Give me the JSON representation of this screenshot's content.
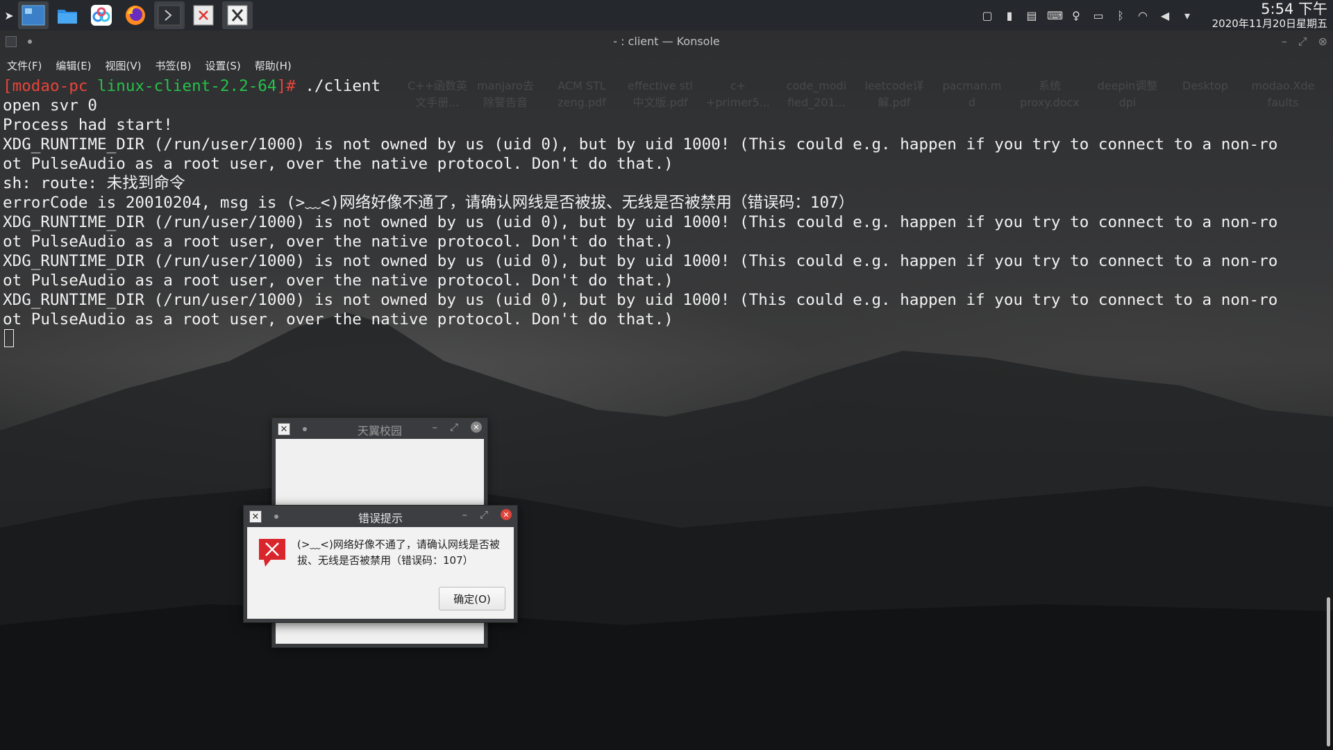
{
  "taskbar": {
    "launcher_icon": "launcher-arrow-icon",
    "tasks": [
      {
        "name": "desktop-icon",
        "active": true
      },
      {
        "name": "file-manager-icon",
        "active": false
      },
      {
        "name": "baidu-netdisk-icon",
        "active": false
      },
      {
        "name": "firefox-icon",
        "active": false
      },
      {
        "name": "konsole-icon",
        "active": true
      },
      {
        "name": "error-app-icon",
        "active": false
      },
      {
        "name": "x-app-icon",
        "active": true
      }
    ],
    "tray_icons": [
      "window-icon",
      "clipboard-icon",
      "notes-icon",
      "keyboard-icon",
      "bulb-icon",
      "battery-icon",
      "bluetooth-icon",
      "wifi-icon",
      "volume-icon",
      "expand-icon"
    ],
    "clock_time": "5:54 下午",
    "clock_date": "2020年11月20日星期五"
  },
  "konsole": {
    "title": "- : client — Konsole",
    "menu": [
      "文件(F)",
      "编辑(E)",
      "视图(V)",
      "书签(B)",
      "设置(S)",
      "帮助(H)"
    ],
    "prompt_user": "[modao-pc",
    "prompt_dir": "linux-client-2.2-64",
    "prompt_mark": "]#",
    "command": " ./client",
    "lines": [
      "open svr 0",
      "Process had start!",
      "XDG_RUNTIME_DIR (/run/user/1000) is not owned by us (uid 0), but by uid 1000! (This could e.g. happen if you try to connect to a non-ro",
      "ot PulseAudio as a root user, over the native protocol. Don't do that.)",
      "sh: route: 未找到命令",
      "errorCode is 20010204, msg is (>﹏<)网络好像不通了，请确认网线是否被拔、无线是否被禁用（错误码：107）",
      "XDG_RUNTIME_DIR (/run/user/1000) is not owned by us (uid 0), but by uid 1000! (This could e.g. happen if you try to connect to a non-ro",
      "ot PulseAudio as a root user, over the native protocol. Don't do that.)",
      "XDG_RUNTIME_DIR (/run/user/1000) is not owned by us (uid 0), but by uid 1000! (This could e.g. happen if you try to connect to a non-ro",
      "ot PulseAudio as a root user, over the native protocol. Don't do that.)",
      "XDG_RUNTIME_DIR (/run/user/1000) is not owned by us (uid 0), but by uid 1000! (This could e.g. happen if you try to connect to a non-ro",
      "ot PulseAudio as a root user, over the native protocol. Don't do that.)"
    ]
  },
  "desktop_labels": [
    {
      "l1": "C++函数英",
      "l2": "文手册..."
    },
    {
      "l1": "manjaro去",
      "l2": "除警告音"
    },
    {
      "l1": "ACM STL",
      "l2": "zeng.pdf"
    },
    {
      "l1": "effective stl",
      "l2": "中文版.pdf"
    },
    {
      "l1": "c+",
      "l2": "+primer5..."
    },
    {
      "l1": "code_modi",
      "l2": "fied_201..."
    },
    {
      "l1": "leetcode详",
      "l2": "解.pdf"
    },
    {
      "l1": "pacman.m",
      "l2": "d"
    },
    {
      "l1": "系统",
      "l2": "proxy.docx"
    },
    {
      "l1": "deepin调整",
      "l2": "dpi"
    },
    {
      "l1": "Desktop",
      "l2": ""
    },
    {
      "l1": "modao.Xde",
      "l2": "faults"
    }
  ],
  "tianyi_window": {
    "title": "天翼校园"
  },
  "error_dialog": {
    "title": "错误提示",
    "message": "(>﹏<)网络好像不通了，请确认网线是否被拔、无线是否被禁用（错误码：107）",
    "ok_label": "确定(O)",
    "icon": "error-icon"
  },
  "colors": {
    "prompt_red": "#e8443a",
    "prompt_green": "#25c24a",
    "close_red": "#e0443a"
  }
}
